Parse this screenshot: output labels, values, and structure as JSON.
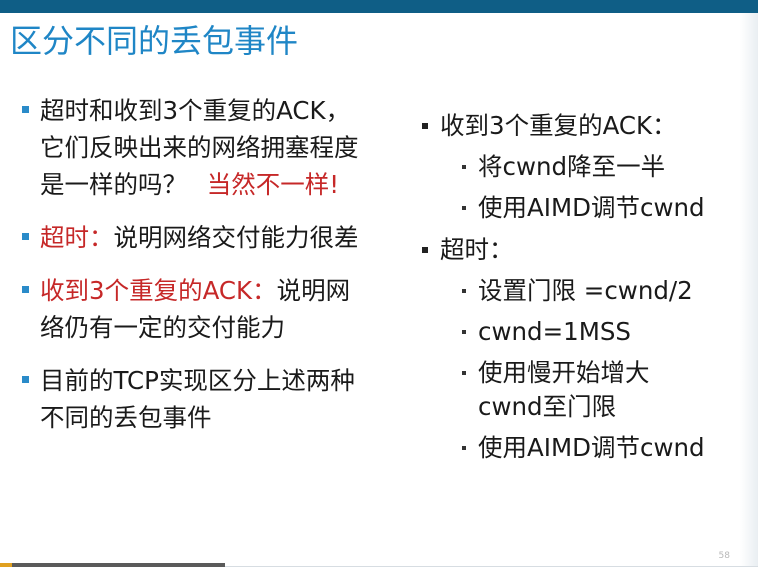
{
  "slide": {
    "title": "区分不同的丢包事件",
    "page_number": "58",
    "colors": {
      "title": "#1f86c6",
      "topbar": "#0f5e86",
      "highlight": "#c62828",
      "bullet": "#2a8bc9"
    }
  },
  "left": {
    "b1_line1": "超时和收到3个重复的ACK，",
    "b1_line2": "它们反映出来的网络拥塞程度",
    "b1_line3": "是一样的吗？",
    "b1_answer": "当然不一样!",
    "b2_head": "超时：",
    "b2_text": "说明网络交付能力很差",
    "b3_head": "收到3个重复的ACK：",
    "b3_text1": "说明网",
    "b3_text2": "络仍有一定的交付能力",
    "b4_line1": "目前的TCP实现区分上述两种",
    "b4_line2": "不同的丢包事件"
  },
  "right": {
    "g1_head": "收到3个重复的ACK：",
    "g1_items": [
      "将cwnd降至一半",
      "使用AIMD调节cwnd"
    ],
    "g2_head": "超时：",
    "g2_item1": "设置门限 =cwnd/2",
    "g2_item2": "cwnd=1MSS",
    "g2_item3_line1": "使用慢开始增大",
    "g2_item3_line2": "cwnd至门限",
    "g2_item4": "使用AIMD调节cwnd"
  }
}
